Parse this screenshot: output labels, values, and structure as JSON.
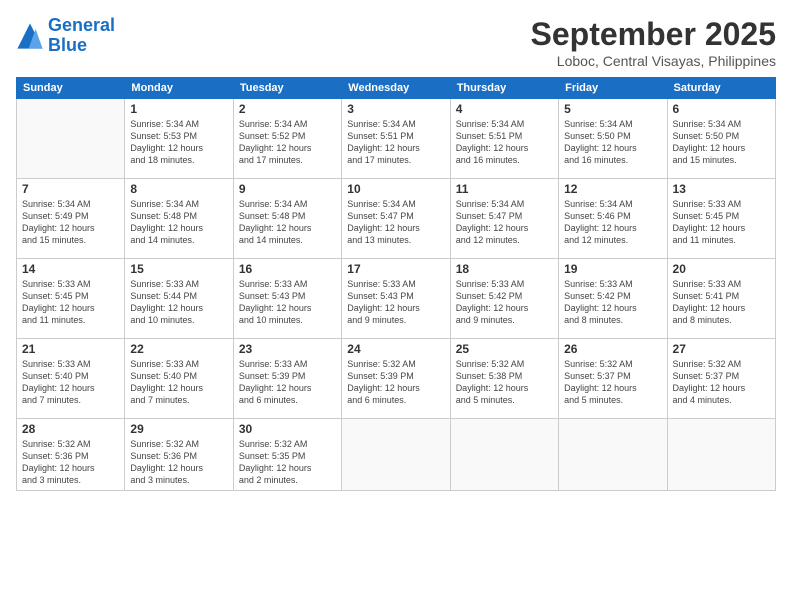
{
  "header": {
    "logo_line1": "General",
    "logo_line2": "Blue",
    "month": "September 2025",
    "location": "Loboc, Central Visayas, Philippines"
  },
  "weekdays": [
    "Sunday",
    "Monday",
    "Tuesday",
    "Wednesday",
    "Thursday",
    "Friday",
    "Saturday"
  ],
  "weeks": [
    [
      {
        "day": "",
        "info": ""
      },
      {
        "day": "1",
        "info": "Sunrise: 5:34 AM\nSunset: 5:53 PM\nDaylight: 12 hours\nand 18 minutes."
      },
      {
        "day": "2",
        "info": "Sunrise: 5:34 AM\nSunset: 5:52 PM\nDaylight: 12 hours\nand 17 minutes."
      },
      {
        "day": "3",
        "info": "Sunrise: 5:34 AM\nSunset: 5:51 PM\nDaylight: 12 hours\nand 17 minutes."
      },
      {
        "day": "4",
        "info": "Sunrise: 5:34 AM\nSunset: 5:51 PM\nDaylight: 12 hours\nand 16 minutes."
      },
      {
        "day": "5",
        "info": "Sunrise: 5:34 AM\nSunset: 5:50 PM\nDaylight: 12 hours\nand 16 minutes."
      },
      {
        "day": "6",
        "info": "Sunrise: 5:34 AM\nSunset: 5:50 PM\nDaylight: 12 hours\nand 15 minutes."
      }
    ],
    [
      {
        "day": "7",
        "info": "Sunrise: 5:34 AM\nSunset: 5:49 PM\nDaylight: 12 hours\nand 15 minutes."
      },
      {
        "day": "8",
        "info": "Sunrise: 5:34 AM\nSunset: 5:48 PM\nDaylight: 12 hours\nand 14 minutes."
      },
      {
        "day": "9",
        "info": "Sunrise: 5:34 AM\nSunset: 5:48 PM\nDaylight: 12 hours\nand 14 minutes."
      },
      {
        "day": "10",
        "info": "Sunrise: 5:34 AM\nSunset: 5:47 PM\nDaylight: 12 hours\nand 13 minutes."
      },
      {
        "day": "11",
        "info": "Sunrise: 5:34 AM\nSunset: 5:47 PM\nDaylight: 12 hours\nand 12 minutes."
      },
      {
        "day": "12",
        "info": "Sunrise: 5:34 AM\nSunset: 5:46 PM\nDaylight: 12 hours\nand 12 minutes."
      },
      {
        "day": "13",
        "info": "Sunrise: 5:33 AM\nSunset: 5:45 PM\nDaylight: 12 hours\nand 11 minutes."
      }
    ],
    [
      {
        "day": "14",
        "info": "Sunrise: 5:33 AM\nSunset: 5:45 PM\nDaylight: 12 hours\nand 11 minutes."
      },
      {
        "day": "15",
        "info": "Sunrise: 5:33 AM\nSunset: 5:44 PM\nDaylight: 12 hours\nand 10 minutes."
      },
      {
        "day": "16",
        "info": "Sunrise: 5:33 AM\nSunset: 5:43 PM\nDaylight: 12 hours\nand 10 minutes."
      },
      {
        "day": "17",
        "info": "Sunrise: 5:33 AM\nSunset: 5:43 PM\nDaylight: 12 hours\nand 9 minutes."
      },
      {
        "day": "18",
        "info": "Sunrise: 5:33 AM\nSunset: 5:42 PM\nDaylight: 12 hours\nand 9 minutes."
      },
      {
        "day": "19",
        "info": "Sunrise: 5:33 AM\nSunset: 5:42 PM\nDaylight: 12 hours\nand 8 minutes."
      },
      {
        "day": "20",
        "info": "Sunrise: 5:33 AM\nSunset: 5:41 PM\nDaylight: 12 hours\nand 8 minutes."
      }
    ],
    [
      {
        "day": "21",
        "info": "Sunrise: 5:33 AM\nSunset: 5:40 PM\nDaylight: 12 hours\nand 7 minutes."
      },
      {
        "day": "22",
        "info": "Sunrise: 5:33 AM\nSunset: 5:40 PM\nDaylight: 12 hours\nand 7 minutes."
      },
      {
        "day": "23",
        "info": "Sunrise: 5:33 AM\nSunset: 5:39 PM\nDaylight: 12 hours\nand 6 minutes."
      },
      {
        "day": "24",
        "info": "Sunrise: 5:32 AM\nSunset: 5:39 PM\nDaylight: 12 hours\nand 6 minutes."
      },
      {
        "day": "25",
        "info": "Sunrise: 5:32 AM\nSunset: 5:38 PM\nDaylight: 12 hours\nand 5 minutes."
      },
      {
        "day": "26",
        "info": "Sunrise: 5:32 AM\nSunset: 5:37 PM\nDaylight: 12 hours\nand 5 minutes."
      },
      {
        "day": "27",
        "info": "Sunrise: 5:32 AM\nSunset: 5:37 PM\nDaylight: 12 hours\nand 4 minutes."
      }
    ],
    [
      {
        "day": "28",
        "info": "Sunrise: 5:32 AM\nSunset: 5:36 PM\nDaylight: 12 hours\nand 3 minutes."
      },
      {
        "day": "29",
        "info": "Sunrise: 5:32 AM\nSunset: 5:36 PM\nDaylight: 12 hours\nand 3 minutes."
      },
      {
        "day": "30",
        "info": "Sunrise: 5:32 AM\nSunset: 5:35 PM\nDaylight: 12 hours\nand 2 minutes."
      },
      {
        "day": "",
        "info": ""
      },
      {
        "day": "",
        "info": ""
      },
      {
        "day": "",
        "info": ""
      },
      {
        "day": "",
        "info": ""
      }
    ]
  ]
}
